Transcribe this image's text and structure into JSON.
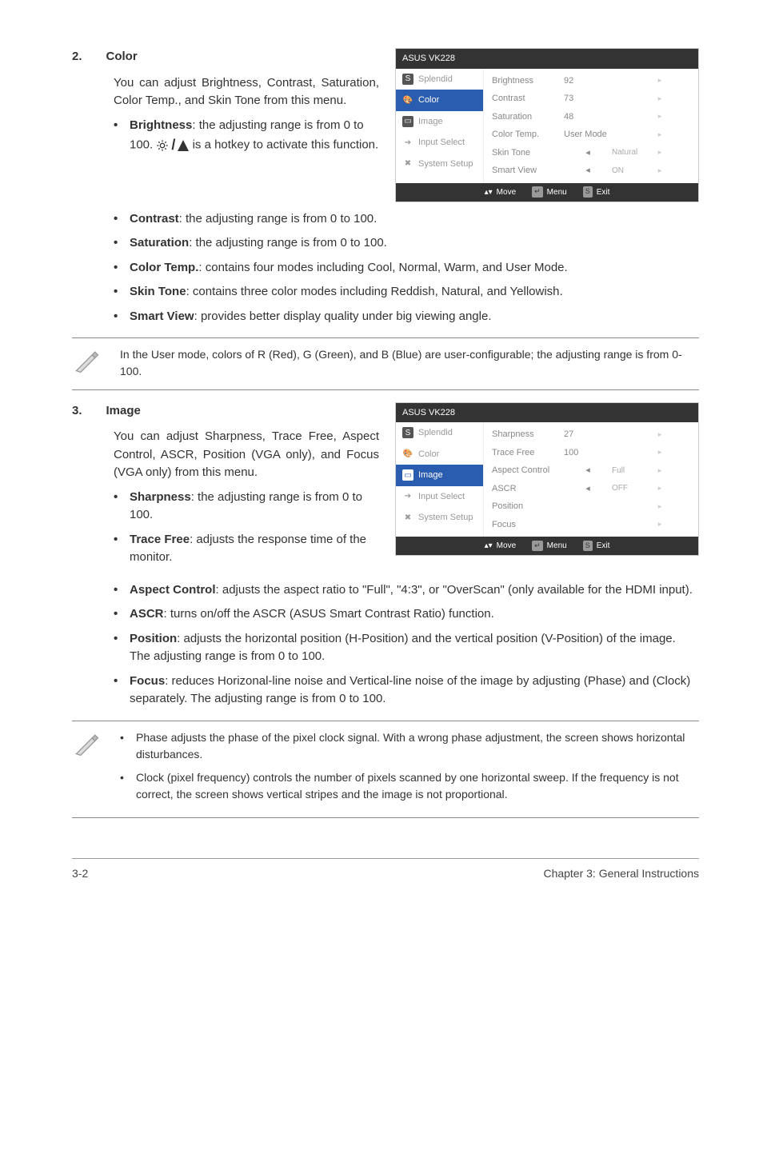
{
  "sec2": {
    "num": "2.",
    "title": "Color",
    "intro": "You can adjust Brightness, Contrast, Saturation, Color Temp., and Skin Tone from this menu.",
    "b_brightness": "Brightness",
    "b_brightness_txt1": ": the adjusting range is from 0 to 100. ",
    "b_brightness_txt2": " is a hotkey to activate this function.",
    "b_contrast": "Contrast",
    "b_contrast_txt": ": the adjusting range is from 0 to 100.",
    "b_saturation": "Saturation",
    "b_saturation_txt": ": the adjusting range is from 0 to 100.",
    "b_colortemp": "Color Temp.",
    "b_colortemp_txt": ": contains four modes including Cool, Normal, Warm, and User Mode.",
    "b_skintone": "Skin Tone",
    "b_skintone_txt": ": contains three color modes including Reddish, Natural, and Yellowish.",
    "b_smartview": "Smart View",
    "b_smartview_txt": ": provides better display quality under big viewing angle.",
    "note": "In the User mode, colors of R (Red), G (Green), and B (Blue) are user-configurable; the adjusting range is from 0-100."
  },
  "sec3": {
    "num": "3.",
    "title": "Image",
    "intro": "You can adjust Sharpness, Trace Free, Aspect Control, ASCR, Position (VGA only), and Focus (VGA only) from this menu.",
    "b_sharp": "Sharpness",
    "b_sharp_txt": ": the adjusting range is from 0 to 100.",
    "b_trace": "Trace Free",
    "b_trace_txt": ": adjusts the response time of the monitor.",
    "b_aspect": "Aspect Control",
    "b_aspect_txt": ": adjusts the aspect ratio to \"Full\", \"4:3\", or \"OverScan\" (only available for the HDMI input).",
    "b_ascr": "ASCR",
    "b_ascr_txt": ": turns on/off the ASCR (ASUS Smart Contrast Ratio) function.",
    "b_pos": "Position",
    "b_pos_txt": ": adjusts the horizontal position (H-Position) and the vertical position (V-Position) of the image. The adjusting range is from 0 to 100.",
    "b_focus": "Focus",
    "b_focus_txt": ": reduces Horizonal-line noise and Vertical-line noise of the image by adjusting (Phase) and (Clock) separately. The adjusting range is from 0 to 100.",
    "note1": "Phase adjusts the phase of the pixel clock signal. With a wrong phase adjustment, the screen shows horizontal disturbances.",
    "note2": "Clock (pixel frequency) controls the number of pixels scanned by one horizontal sweep. If the frequency is not correct, the screen shows vertical stripes and the image is not proportional."
  },
  "osd": {
    "title": "ASUS VK228",
    "menu_splendid": "Splendid",
    "menu_color": "Color",
    "menu_image": "Image",
    "menu_input": "Input Select",
    "menu_system": "System Setup",
    "foot_move": "Move",
    "foot_menu": "Menu",
    "foot_exit": "Exit",
    "key_menu": "↵",
    "key_exit": "S"
  },
  "osd1": {
    "r1l": "Brightness",
    "r1v": "92",
    "r2l": "Contrast",
    "r2v": "73",
    "r3l": "Saturation",
    "r3v": "48",
    "r4l": "Color Temp.",
    "r4v": "User Mode",
    "r5l": "Skin Tone",
    "r5arrow": "◂",
    "r5v": "Natural",
    "r6l": "Smart View",
    "r6arrow": "◂",
    "r6v": "ON"
  },
  "osd2": {
    "r1l": "Sharpness",
    "r1v": "27",
    "r2l": "Trace Free",
    "r2v": "100",
    "r3l": "Aspect Control",
    "r3arrow": "◂",
    "r3v": "Full",
    "r4l": "ASCR",
    "r4arrow": "◂",
    "r4v": "OFF",
    "r5l": "Position",
    "r6l": "Focus"
  },
  "footer": {
    "left": "3-2",
    "right": "Chapter 3: General Instructions"
  }
}
